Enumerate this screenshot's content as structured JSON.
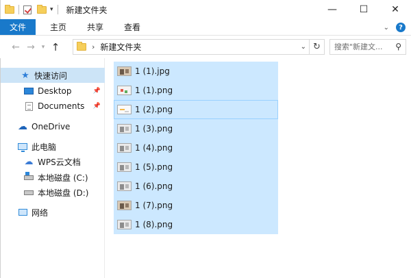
{
  "window": {
    "title": "新建文件夹",
    "minimize_glyph": "—",
    "maximize_glyph": "☐",
    "close_glyph": "✕"
  },
  "quick_access_toolbar": {
    "dropdown_glyph": "▾"
  },
  "ribbon": {
    "tabs": [
      {
        "label": "文件"
      },
      {
        "label": "主页"
      },
      {
        "label": "共享"
      },
      {
        "label": "查看"
      }
    ],
    "collapse_glyph": "⌄",
    "help_glyph": "?"
  },
  "navigation": {
    "back_glyph": "←",
    "forward_glyph": "→",
    "recent_glyph": "▾",
    "up_glyph": "↑"
  },
  "address_bar": {
    "separator_glyph": "›",
    "path": "新建文件夹",
    "dropdown_glyph": "⌄",
    "refresh_glyph": "↻"
  },
  "search": {
    "placeholder": "搜索\"新建文...",
    "icon_glyph": "⚲"
  },
  "nav_pane": {
    "items": [
      {
        "label": "快速访问",
        "icon": "star-icon"
      },
      {
        "label": "Desktop",
        "icon": "desktop-icon",
        "pinned": true
      },
      {
        "label": "Documents",
        "icon": "documents-icon",
        "pinned": true
      },
      {
        "label": "OneDrive",
        "icon": "cloud-icon"
      },
      {
        "label": "此电脑",
        "icon": "computer-icon"
      },
      {
        "label": "WPS云文档",
        "icon": "wps-cloud-icon"
      },
      {
        "label": "本地磁盘 (C:)",
        "icon": "drive-icon"
      },
      {
        "label": "本地磁盘 (D:)",
        "icon": "drive-icon"
      },
      {
        "label": "网络",
        "icon": "network-icon"
      }
    ],
    "pin_glyph": "📌"
  },
  "files": [
    {
      "name": "1 (1).jpg",
      "thumb": "photo"
    },
    {
      "name": "1 (1).png",
      "thumb": "chart"
    },
    {
      "name": "1 (2).png",
      "thumb": "blank"
    },
    {
      "name": "1 (3).png",
      "thumb": "gray"
    },
    {
      "name": "1 (4).png",
      "thumb": "gray"
    },
    {
      "name": "1 (5).png",
      "thumb": "gray"
    },
    {
      "name": "1 (6).png",
      "thumb": "gray"
    },
    {
      "name": "1 (7).png",
      "thumb": "photo"
    },
    {
      "name": "1 (8).png",
      "thumb": "gray"
    }
  ],
  "colors": {
    "file_tab": "#1979ca",
    "selection": "#cce8ff",
    "nav_selected": "#cce4f7"
  }
}
